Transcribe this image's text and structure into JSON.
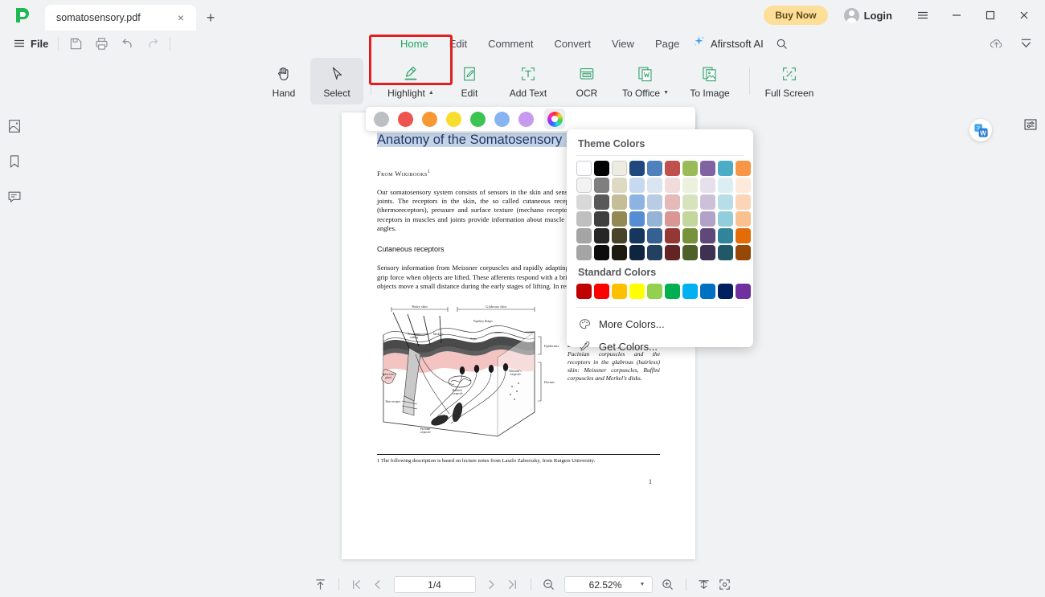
{
  "titlebar": {
    "logo": "app-logo",
    "tab": {
      "title": "somatosensory.pdf",
      "close": "×"
    },
    "new_tab": "+",
    "buy_now": "Buy Now",
    "login": "Login",
    "menu_icon": "hamburger-icon",
    "minimize": "—",
    "maximize": "□",
    "close": "×"
  },
  "menurow": {
    "file": "File",
    "quick_actions": [
      "save-icon",
      "print-icon",
      "undo-icon",
      "redo-icon"
    ],
    "tabs": [
      {
        "label": "Home",
        "active": true
      },
      {
        "label": "Edit",
        "active": false
      },
      {
        "label": "Comment",
        "active": false
      },
      {
        "label": "Convert",
        "active": false
      },
      {
        "label": "View",
        "active": false
      },
      {
        "label": "Page",
        "active": false
      }
    ],
    "ai_label": "Afirstsoft AI",
    "search_icon": "search-icon",
    "right_icons": [
      "cloud-upload-icon",
      "collapse-ribbon-icon"
    ]
  },
  "ribbon": {
    "tools": [
      {
        "name": "hand",
        "label": "Hand",
        "icon": "hand-icon",
        "selected": false,
        "caret": false
      },
      {
        "name": "select",
        "label": "Select",
        "icon": "cursor-icon",
        "selected": true,
        "caret": false
      },
      {
        "name": "highlight",
        "label": "Highlight",
        "icon": "highlighter-icon",
        "selected": false,
        "caret": true,
        "outlined": true
      },
      {
        "name": "edit",
        "label": "Edit",
        "icon": "edit-page-icon",
        "selected": false,
        "caret": false
      },
      {
        "name": "add-text",
        "label": "Add Text",
        "icon": "add-text-icon",
        "selected": false,
        "caret": false
      },
      {
        "name": "ocr",
        "label": "OCR",
        "icon": "ocr-icon",
        "selected": false,
        "caret": false
      },
      {
        "name": "to-office",
        "label": "To Office",
        "icon": "to-office-icon",
        "selected": false,
        "caret": true
      },
      {
        "name": "to-image",
        "label": "To Image",
        "icon": "to-image-icon",
        "selected": false,
        "caret": false
      },
      {
        "name": "full-screen",
        "label": "Full Screen",
        "icon": "fullscreen-icon",
        "selected": false,
        "caret": false
      }
    ],
    "highlight_outline_color": "#e02020"
  },
  "swatchbar": {
    "colors": [
      "#bdbfc3",
      "#ef5350",
      "#f79833",
      "#f7dd2e",
      "#3bc452",
      "#89b4f2",
      "#c79af0"
    ],
    "wheel": "color-wheel-icon"
  },
  "colorpanel": {
    "theme_title": "Theme Colors",
    "theme_rows": [
      [
        "#ffffff",
        "#000000",
        "#eeece1",
        "#1f497d",
        "#4f81bd",
        "#c0504d",
        "#9bbb59",
        "#8064a2",
        "#4bacc6",
        "#f79646"
      ],
      [
        "#f2f2f2",
        "#7f7f7f",
        "#ddd9c3",
        "#c6d9f0",
        "#dbe5f1",
        "#f2dcdb",
        "#ebf1dd",
        "#e5e0ec",
        "#dbeef3",
        "#fdeada"
      ],
      [
        "#d8d8d8",
        "#595959",
        "#c4bd97",
        "#8db3e2",
        "#b8cce4",
        "#e5b9b7",
        "#d7e3bc",
        "#ccc1d9",
        "#b7dde8",
        "#fbd5b5"
      ],
      [
        "#bfbfbf",
        "#3f3f3f",
        "#938953",
        "#548dd4",
        "#95b3d7",
        "#d99694",
        "#c3d69b",
        "#b2a2c7",
        "#92cddc",
        "#fac08f"
      ],
      [
        "#a5a5a5",
        "#262626",
        "#494429",
        "#17365d",
        "#366092",
        "#953734",
        "#76923c",
        "#5f497a",
        "#31859b",
        "#e36c09"
      ],
      [
        "#a5a5a5",
        "#0c0c0c",
        "#1d1b10",
        "#0f243e",
        "#244061",
        "#632423",
        "#4f6128",
        "#3f3151",
        "#205867",
        "#974806"
      ]
    ],
    "standard_title": "Standard Colors",
    "standard_row": [
      "#c00000",
      "#ff0000",
      "#ffc000",
      "#ffff00",
      "#92d050",
      "#00b050",
      "#00b0f0",
      "#0070c0",
      "#002060",
      "#7030a0"
    ],
    "more_colors": "More Colors...",
    "more_colors_icon": "palette-icon",
    "get_colors": "Get Colors...",
    "get_colors_icon": "eyedropper-icon"
  },
  "left_rail": [
    {
      "name": "thumbnails",
      "icon": "thumbnail-icon"
    },
    {
      "name": "bookmarks",
      "icon": "bookmark-icon"
    },
    {
      "name": "comments",
      "icon": "comment-icon"
    }
  ],
  "right_rail": [
    {
      "name": "properties",
      "icon": "sliders-icon"
    }
  ],
  "document": {
    "word_badge": "word-convert-badge",
    "title": "Anatomy of the Somatosensory System",
    "byline": "From Wikibooks",
    "byline_sup": "1",
    "paragraph1": "Our somatosensory system consists of sensors in the skin and sensors in our muscles, tendons, and joints. The receptors in the skin, the so called cutaneous receptors, tell us about temperature (thermoreceptors), pressure and surface texture (mechano receptors), and pain (nociceptors). The receptors in muscles and joints provide information about muscle length, muscle tension, and joint angles.",
    "heading2": "Cutaneous receptors",
    "paragraph2": "Sensory information from Meissner corpuscles and rapidly adapting afferents leads to adjustment of grip force when objects are lifted. These afferents respond with a brief burst of action potentials when objects move a small distance during the early stages of lifting. In response to",
    "figure_caption": "Figure 1: Receptors in the human skin: Mechanoreceptors can be free receptors or encapsulated. Examples for free receptors are the hair receptors at the roots of hairs. Encapsulated receptors are the Pacinian corpuscles and the receptors in the glabrous (hairless) skin: Meissner corpuscles, Ruffini corpuscles and Merkel's disks.",
    "figure_labels": [
      "Hairy skin",
      "Glabrous skin",
      "Epidermis",
      "Dermis",
      "Free nerve ending",
      "Merkel's",
      "Papillary Ridges",
      "Septa",
      "Sebaceous gland",
      "Hair receptor",
      "Ruffini's corpuscle",
      "Meissner's corpuscle",
      "Pacinian corpuscle"
    ],
    "footnote": "1 The following description is based on lecture notes from Laszlo Zaborszky, from Rutgers University.",
    "page_number": "1"
  },
  "statusbar": {
    "scroll_top_icon": "scroll-to-top-icon",
    "first_page_icon": "first-page-icon",
    "prev_page_icon": "prev-page-icon",
    "page_value": "1/4",
    "next_page_icon": "next-page-icon",
    "last_page_icon": "last-page-icon",
    "zoom_out_icon": "zoom-out-icon",
    "zoom_value": "62.52%",
    "zoom_caret": "▼",
    "zoom_in_icon": "zoom-in-icon",
    "fit_width_icon": "fit-width-icon",
    "fit_page_icon": "fit-page-icon"
  }
}
